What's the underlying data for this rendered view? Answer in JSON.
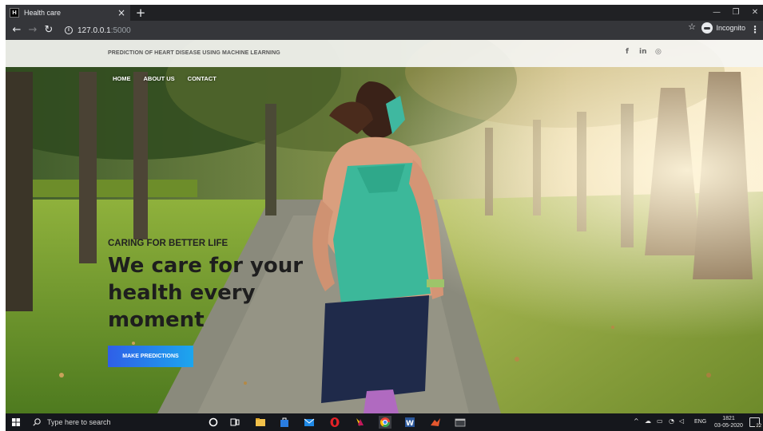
{
  "browser": {
    "tab_title": "Health care",
    "favicon_letter": "H",
    "url_host": "127.0.0.1",
    "url_port": ":5000",
    "profile_label": "Incognito"
  },
  "site": {
    "title": "PREDICTION OF HEART DISEASE USING MACHINE LEARNING",
    "social": [
      "f",
      "in",
      "◎"
    ],
    "nav": [
      "HOME",
      "ABOUT US",
      "CONTACT"
    ],
    "tagline": "CARING FOR BETTER LIFE",
    "headline": "We care for your health every moment",
    "cta_label": "MAKE PREDICTIONS"
  },
  "taskbar": {
    "search_placeholder": "Type here to search",
    "language": "ENG",
    "time": "1821",
    "date": "03-05-2020",
    "notification_count": "22"
  },
  "colors": {
    "cta_start": "#2f5fe8",
    "cta_end": "#1ca6ee",
    "chrome_dark": "#35363a"
  }
}
